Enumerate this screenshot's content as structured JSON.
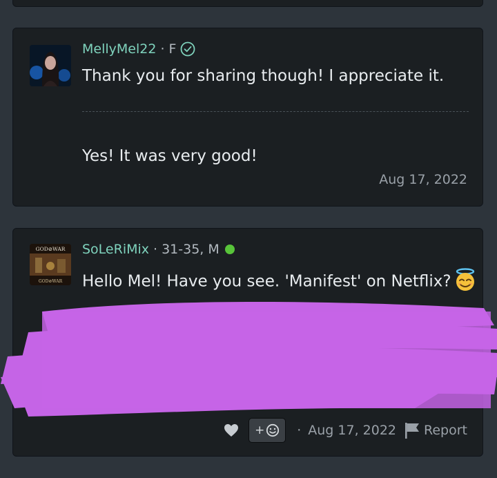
{
  "posts": [
    {
      "username": "MellyMel22",
      "meta": "F",
      "verified": true,
      "messages": [
        "Thank you for sharing though! I appreciate it.",
        "Yes! It was very good!"
      ],
      "date": "Aug 17, 2022"
    },
    {
      "username": "SoLeRiMix",
      "meta": "31-35, M",
      "online": true,
      "message": "Hello Mel! Have you see. 'Manifest' on Netflix?",
      "emoji": "smiling-face-with-halo",
      "avatar_text": "GOD OF WAR",
      "footer": {
        "react_label": "+",
        "date": "Aug 17, 2022",
        "report_label": "Report"
      }
    }
  ],
  "colors": {
    "background": "#2d343b",
    "card": "#1b1f22",
    "username": "#7fd3bd",
    "online": "#58c43a",
    "redaction": "#c564e6"
  }
}
